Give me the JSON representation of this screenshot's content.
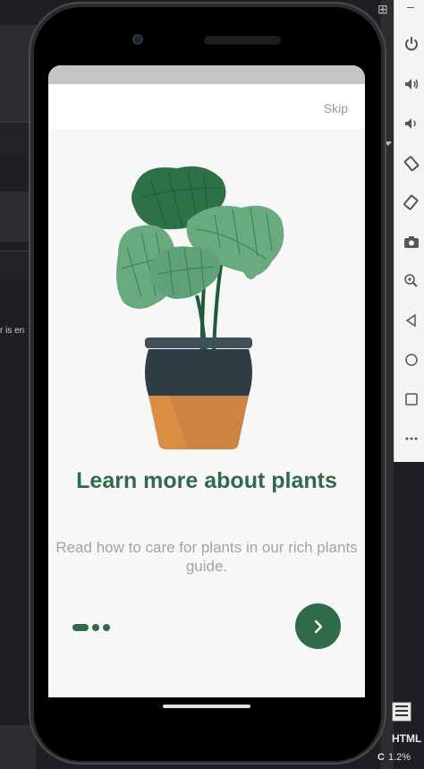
{
  "ide": {
    "log_fragment": "r is en",
    "right_letter": "r",
    "status_html": "HTML",
    "status_c": "C",
    "status_percent": "1.2%"
  },
  "emulator_toolbar": {
    "icons": [
      "power-icon",
      "volume-up-icon",
      "volume-down-icon",
      "rotate-left-icon",
      "rotate-right-icon",
      "camera-icon",
      "zoom-icon",
      "back-icon",
      "home-icon",
      "overview-icon",
      "more-icon"
    ]
  },
  "app": {
    "skip_label": "Skip",
    "title": "Learn more about plants",
    "subtitle": "Read how to care for plants in our rich plants guide.",
    "page_indicator": {
      "count": 3,
      "active": 0
    },
    "colors": {
      "primary": "#2f6b49",
      "subtitle": "#a3a3a3",
      "background": "#f7f7f7"
    }
  }
}
